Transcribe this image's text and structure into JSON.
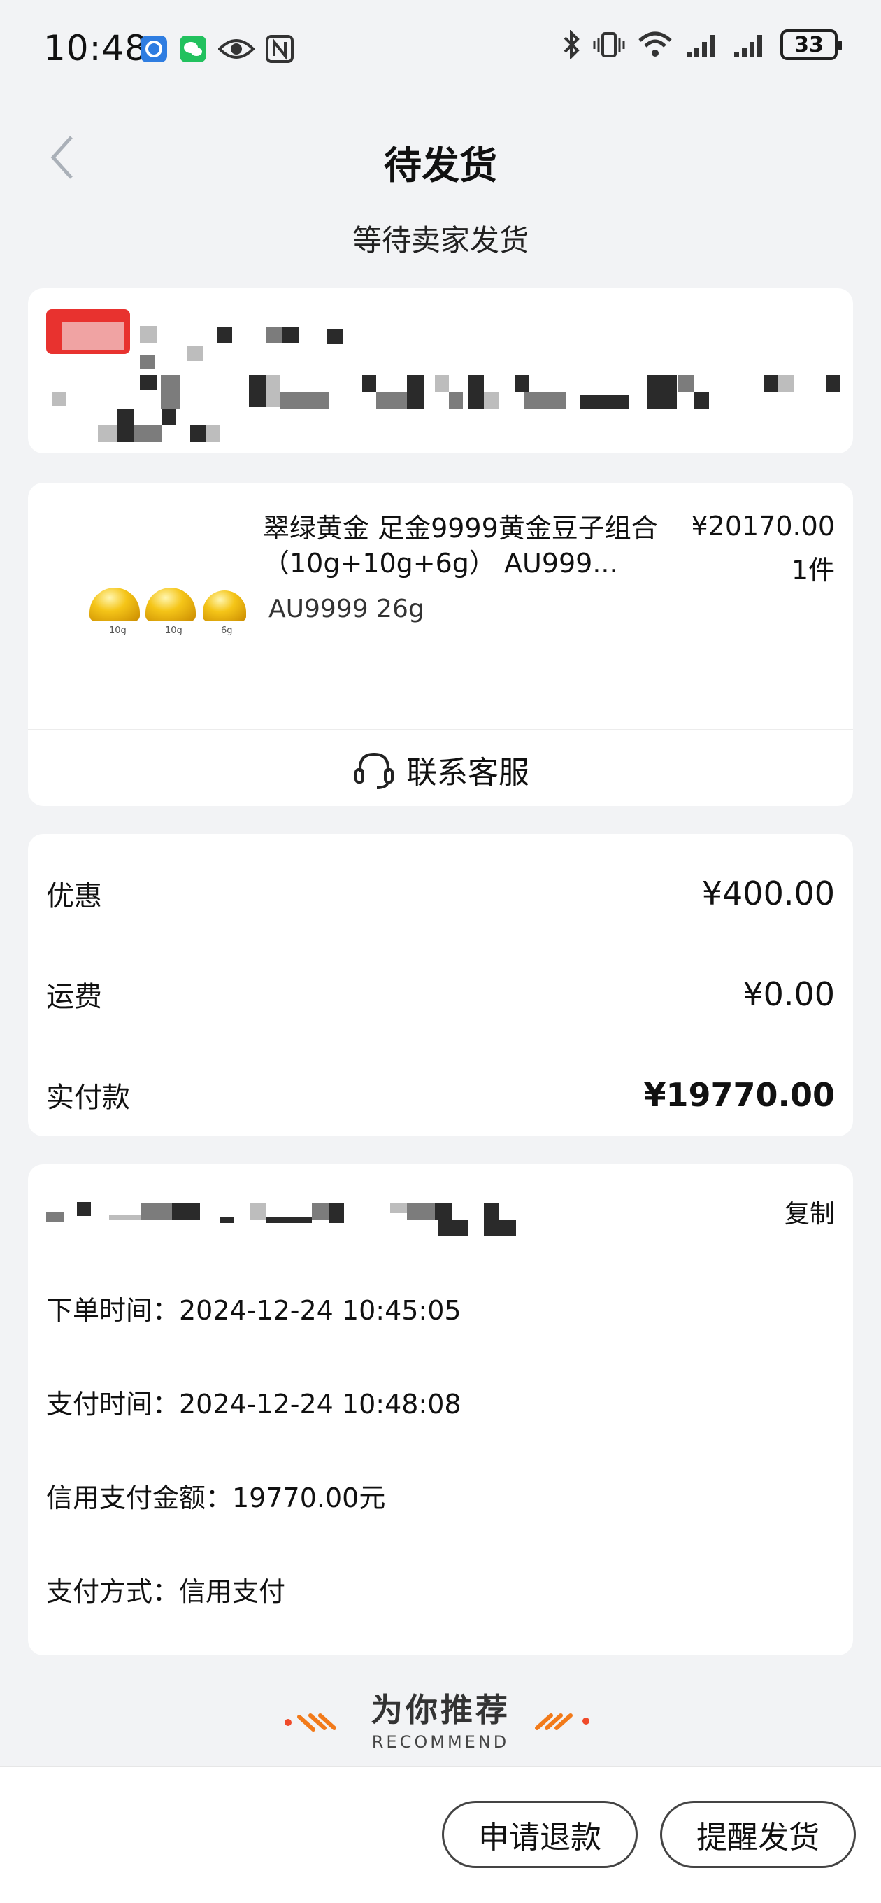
{
  "status_bar": {
    "time": "10:48",
    "battery": "33",
    "icons": [
      "app-shield-icon",
      "wechat-icon",
      "eye-icon",
      "nfc-icon",
      "bluetooth-icon",
      "vibrate-icon",
      "wifi-icon",
      "signal-icon",
      "signal-icon"
    ]
  },
  "nav": {
    "title": "待发货"
  },
  "order_status": "等待卖家发货",
  "product": {
    "name": "翠绿黄金 足金9999黄金豆子组合 （10g+10g+6g） AU999...",
    "spec": "AU9999 26g",
    "price": "¥20170.00",
    "quantity": "1件",
    "image_labels": [
      "10g",
      "10g",
      "6g"
    ]
  },
  "customer_service": "联系客服",
  "fees": {
    "discount_label": "优惠",
    "discount_value": "¥400.00",
    "shipping_label": "运费",
    "shipping_value": "¥0.00",
    "paid_label": "实付款",
    "paid_value": "¥19770.00"
  },
  "order_info": {
    "copy": "复制",
    "order_time": "下单时间：2024-12-24 10:45:05",
    "pay_time": "支付时间：2024-12-24 10:48:08",
    "credit_amount": "信用支付金额：19770.00元",
    "pay_method": "支付方式：信用支付"
  },
  "recommend": {
    "title": "为你推荐",
    "subtitle": "RECOMMEND"
  },
  "actions": {
    "refund": "申请退款",
    "remind": "提醒发货"
  }
}
